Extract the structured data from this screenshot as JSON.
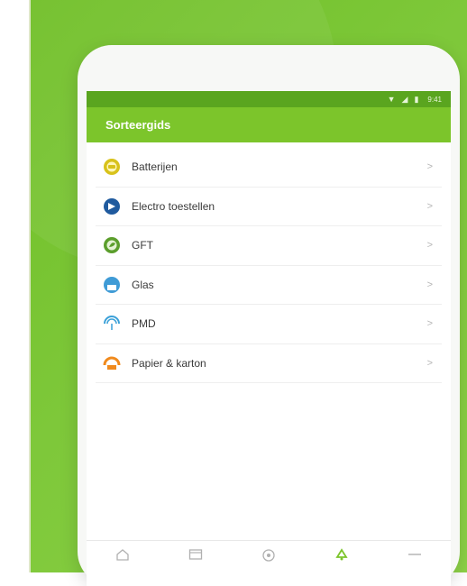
{
  "app": {
    "title": "Sorteergids",
    "time": "9:41"
  },
  "colors": {
    "brand_green": "#7cc52b",
    "status_green": "#5aa51f",
    "background_green": "#7ec83a"
  },
  "items": [
    {
      "label": "Batterijen",
      "icon": "battery-icon",
      "color": "#d8c21a"
    },
    {
      "label": "Electro toestellen",
      "icon": "electro-icon",
      "color": "#1f5a9e"
    },
    {
      "label": "GFT",
      "icon": "gft-icon",
      "color": "#5b9e2c"
    },
    {
      "label": "Glas",
      "icon": "glass-icon",
      "color": "#3f9bd6"
    },
    {
      "label": "PMD",
      "icon": "pmd-icon",
      "color": "#3aa0d8"
    },
    {
      "label": "Papier & karton",
      "icon": "paper-icon",
      "color": "#f08a1d"
    }
  ],
  "bottom_nav": [
    {
      "icon": "home-icon",
      "active": false
    },
    {
      "icon": "calendar-icon",
      "active": false
    },
    {
      "icon": "location-icon",
      "active": false
    },
    {
      "icon": "recycle-icon",
      "active": true
    },
    {
      "icon": "more-icon",
      "active": false
    }
  ]
}
